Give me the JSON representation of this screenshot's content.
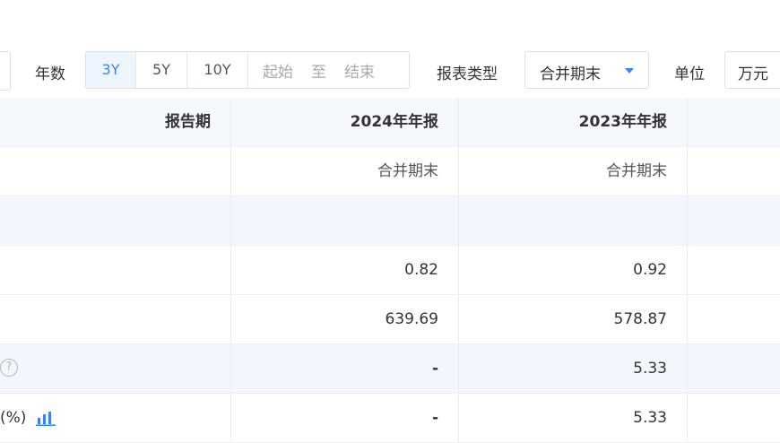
{
  "filters": {
    "years_label": "年数",
    "year_options": [
      "3Y",
      "5Y",
      "10Y"
    ],
    "active_year": "3Y",
    "range_start": "起始",
    "range_to": "至",
    "range_end": "结束",
    "report_type_label": "报表类型",
    "report_type_value": "合并期末",
    "unit_label": "单位",
    "unit_value": "万元"
  },
  "table": {
    "header_label": "报告期",
    "periods": [
      "2024年年报",
      "2023年年报"
    ],
    "report_types": [
      "合并期末",
      "合并期末"
    ],
    "rows": [
      {
        "values": [
          "",
          ""
        ]
      },
      {
        "values": [
          "0.82",
          "0.92"
        ]
      },
      {
        "values": [
          "639.69",
          "578.87"
        ]
      },
      {
        "values": [
          "-",
          "5.33"
        ]
      },
      {
        "label_fragment": "(%)",
        "values": [
          "-",
          "5.33"
        ]
      }
    ]
  },
  "colors": {
    "accent": "#3b82f6",
    "header_bg": "#f5f8fd",
    "alt_row_bg": "#f3f7fd"
  }
}
